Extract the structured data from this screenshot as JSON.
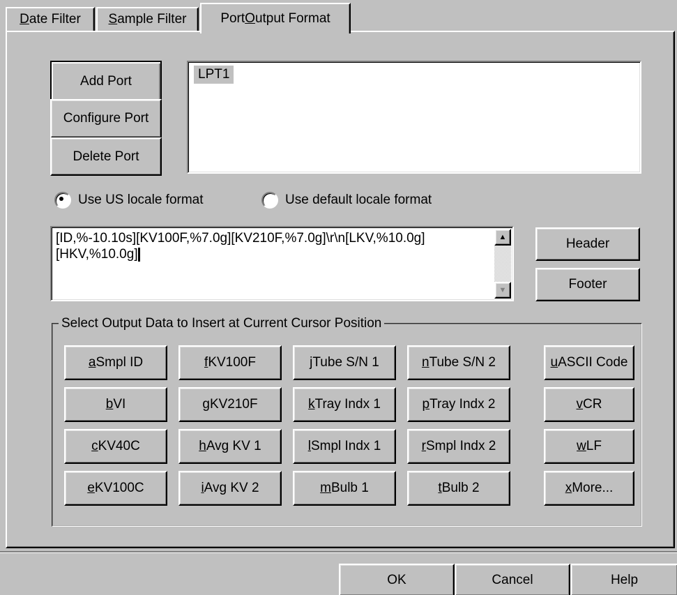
{
  "tabs": [
    {
      "pre": "",
      "key": "D",
      "post": "ate Filter"
    },
    {
      "pre": "",
      "key": "S",
      "post": "ample Filter"
    },
    {
      "pre": "Port ",
      "key": "O",
      "post": "utput Format"
    }
  ],
  "port_buttons": {
    "add": "Add Port",
    "configure": "Configure Port",
    "delete": "Delete Port"
  },
  "port_list": {
    "items": [
      "LPT1"
    ]
  },
  "locale": {
    "us": "Use US locale format",
    "default": "Use default locale format",
    "selected": "us"
  },
  "format_text": {
    "line1": "[ID,%-10.10s][KV100F,%7.0g][KV210F,%7.0g]\\r\\n[LKV,%10.0g]",
    "line2": "[HKV,%10.0g]"
  },
  "side_buttons": {
    "header": "Header",
    "footer": "Footer"
  },
  "group": {
    "label": "Select Output Data to Insert at Current Cursor Position",
    "buttons": [
      [
        {
          "key": "a",
          "label": " Smpl ID"
        },
        {
          "key": "f",
          "label": " KV100F"
        },
        {
          "key": "j",
          "label": " Tube S/N 1"
        },
        {
          "key": "n",
          "label": " Tube S/N 2"
        },
        {
          "key": "u",
          "label": " ASCII Code"
        }
      ],
      [
        {
          "key": "b",
          "label": " VI"
        },
        {
          "key": "g",
          "label": " KV210F"
        },
        {
          "key": "k",
          "label": " Tray Indx 1"
        },
        {
          "key": "p",
          "label": " Tray Indx 2"
        },
        {
          "key": "v",
          "label": " CR"
        }
      ],
      [
        {
          "key": "c",
          "label": " KV40C"
        },
        {
          "key": "h",
          "label": " Avg KV 1"
        },
        {
          "key": "l",
          "label": " Smpl Indx 1"
        },
        {
          "key": "r",
          "label": " Smpl Indx 2"
        },
        {
          "key": "w",
          "label": " LF"
        }
      ],
      [
        {
          "key": "e",
          "label": " KV100C"
        },
        {
          "key": "i",
          "label": " Avg KV 2"
        },
        {
          "key": "m",
          "label": " Bulb 1"
        },
        {
          "key": "t",
          "label": " Bulb 2"
        },
        {
          "key": "x",
          "label": " More..."
        }
      ]
    ]
  },
  "dialog_buttons": {
    "ok": "OK",
    "cancel": "Cancel",
    "help": "Help"
  }
}
